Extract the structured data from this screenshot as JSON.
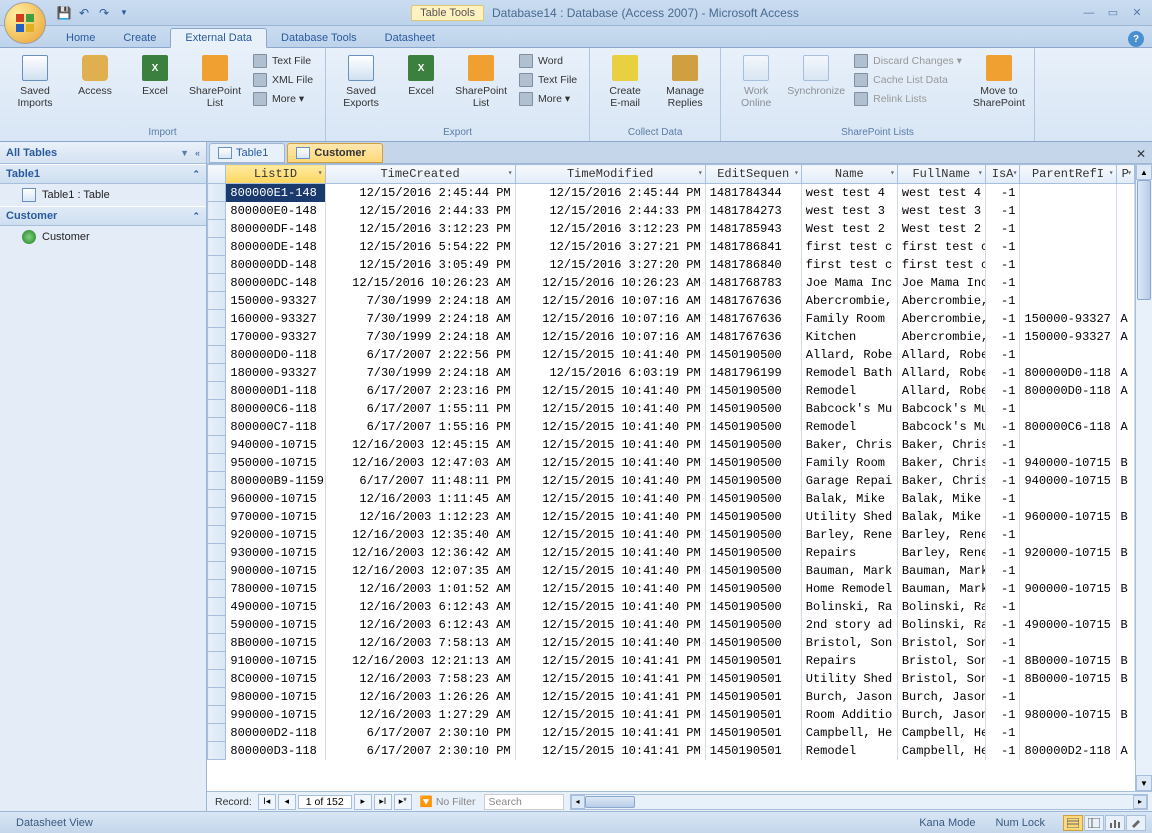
{
  "title": {
    "table_tools": "Table Tools",
    "text": "Database14 : Database (Access 2007) - Microsoft Access"
  },
  "tabs": [
    "Home",
    "Create",
    "External Data",
    "Database Tools",
    "Datasheet"
  ],
  "active_tab": "External Data",
  "ribbon": {
    "groups": [
      {
        "label": "Import",
        "items_big": [
          {
            "label": "Saved\nImports",
            "icon": "db"
          },
          {
            "label": "Access",
            "icon": "key"
          },
          {
            "label": "Excel",
            "icon": "xl"
          },
          {
            "label": "SharePoint\nList",
            "icon": "sp"
          }
        ],
        "items_small": [
          {
            "label": "Text File"
          },
          {
            "label": "XML File"
          },
          {
            "label": "More ▾"
          }
        ]
      },
      {
        "label": "Export",
        "items_big": [
          {
            "label": "Saved\nExports",
            "icon": "db"
          },
          {
            "label": "Excel",
            "icon": "xl"
          },
          {
            "label": "SharePoint\nList",
            "icon": "sp"
          }
        ],
        "items_small": [
          {
            "label": "Word"
          },
          {
            "label": "Text File"
          },
          {
            "label": "More ▾"
          }
        ]
      },
      {
        "label": "Collect Data",
        "items_big": [
          {
            "label": "Create\nE-mail",
            "icon": "mail"
          },
          {
            "label": "Manage\nReplies",
            "icon": "people"
          }
        ],
        "items_small": []
      },
      {
        "label": "SharePoint Lists",
        "items_big": [
          {
            "label": "Work\nOnline",
            "icon": "db",
            "disabled": true
          },
          {
            "label": "Synchronize",
            "icon": "db",
            "disabled": true
          }
        ],
        "items_small": [
          {
            "label": "Discard Changes ▾",
            "disabled": true
          },
          {
            "label": "Cache List Data",
            "disabled": true
          },
          {
            "label": "Relink Lists",
            "disabled": true
          }
        ],
        "extra_big": [
          {
            "label": "Move to\nSharePoint",
            "icon": "sp"
          }
        ]
      }
    ]
  },
  "nav": {
    "header": "All Tables",
    "groups": [
      {
        "name": "Table1",
        "items": [
          {
            "label": "Table1 : Table",
            "icon": "table"
          }
        ]
      },
      {
        "name": "Customer",
        "items": [
          {
            "label": "Customer",
            "icon": "link"
          }
        ]
      }
    ]
  },
  "doc_tabs": [
    {
      "label": "Table1",
      "active": false
    },
    {
      "label": "Customer",
      "active": true
    }
  ],
  "columns": [
    "ListID",
    "TimeCreated",
    "TimeModified",
    "EditSequen",
    "Name",
    "FullName",
    "IsA",
    "ParentRefI",
    "P"
  ],
  "selected_column": "ListID",
  "rows": [
    [
      "800000E1-148",
      "12/15/2016 2:45:44 PM",
      "12/15/2016 2:45:44 PM",
      "1481784344",
      "west test 4",
      "west test 4",
      "-1",
      "",
      ""
    ],
    [
      "800000E0-148",
      "12/15/2016 2:44:33 PM",
      "12/15/2016 2:44:33 PM",
      "1481784273",
      "west test 3",
      "west test 3",
      "-1",
      "",
      ""
    ],
    [
      "800000DF-148",
      "12/15/2016 3:12:23 PM",
      "12/15/2016 3:12:23 PM",
      "1481785943",
      "West test 2",
      "West test 2",
      "-1",
      "",
      ""
    ],
    [
      "800000DE-148",
      "12/15/2016 5:54:22 PM",
      "12/15/2016 3:27:21 PM",
      "1481786841",
      "first test c",
      "first test c",
      "-1",
      "",
      ""
    ],
    [
      "800000DD-148",
      "12/15/2016 3:05:49 PM",
      "12/15/2016 3:27:20 PM",
      "1481786840",
      "first test c",
      "first test c",
      "-1",
      "",
      ""
    ],
    [
      "800000DC-148",
      "12/15/2016 10:26:23 AM",
      "12/15/2016 10:26:23 AM",
      "1481768783",
      "Joe Mama Inc",
      "Joe Mama Inc",
      "-1",
      "",
      ""
    ],
    [
      "150000-93327",
      "7/30/1999 2:24:18 AM",
      "12/15/2016 10:07:16 AM",
      "1481767636",
      "Abercrombie,",
      "Abercrombie,",
      "-1",
      "",
      ""
    ],
    [
      "160000-93327",
      "7/30/1999 2:24:18 AM",
      "12/15/2016 10:07:16 AM",
      "1481767636",
      "Family Room",
      "Abercrombie,",
      "-1",
      "150000-93327",
      "A"
    ],
    [
      "170000-93327",
      "7/30/1999 2:24:18 AM",
      "12/15/2016 10:07:16 AM",
      "1481767636",
      "Kitchen",
      "Abercrombie,",
      "-1",
      "150000-93327",
      "A"
    ],
    [
      "800000D0-118",
      "6/17/2007 2:22:56 PM",
      "12/15/2015 10:41:40 PM",
      "1450190500",
      "Allard, Robe",
      "Allard, Robe",
      "-1",
      "",
      ""
    ],
    [
      "180000-93327",
      "7/30/1999 2:24:18 AM",
      "12/15/2016 6:03:19 PM",
      "1481796199",
      "Remodel Bath",
      "Allard, Robe",
      "-1",
      "800000D0-118",
      "A"
    ],
    [
      "800000D1-118",
      "6/17/2007 2:23:16 PM",
      "12/15/2015 10:41:40 PM",
      "1450190500",
      "Remodel",
      "Allard, Robe",
      "-1",
      "800000D0-118",
      "A"
    ],
    [
      "800000C6-118",
      "6/17/2007 1:55:11 PM",
      "12/15/2015 10:41:40 PM",
      "1450190500",
      "Babcock's Mu",
      "Babcock's Mu",
      "-1",
      "",
      ""
    ],
    [
      "800000C7-118",
      "6/17/2007 1:55:16 PM",
      "12/15/2015 10:41:40 PM",
      "1450190500",
      "Remodel",
      "Babcock's Mu",
      "-1",
      "800000C6-118",
      "A"
    ],
    [
      "940000-10715",
      "12/16/2003 12:45:15 AM",
      "12/15/2015 10:41:40 PM",
      "1450190500",
      "Baker, Chris",
      "Baker, Chris",
      "-1",
      "",
      ""
    ],
    [
      "950000-10715",
      "12/16/2003 12:47:03 AM",
      "12/15/2015 10:41:40 PM",
      "1450190500",
      "Family Room",
      "Baker, Chris",
      "-1",
      "940000-10715",
      "B"
    ],
    [
      "800000B9-1159",
      "6/17/2007 11:48:11 PM",
      "12/15/2015 10:41:40 PM",
      "1450190500",
      "Garage Repai",
      "Baker, Chris",
      "-1",
      "940000-10715",
      "B"
    ],
    [
      "960000-10715",
      "12/16/2003 1:11:45 AM",
      "12/15/2015 10:41:40 PM",
      "1450190500",
      "Balak, Mike",
      "Balak, Mike",
      "-1",
      "",
      ""
    ],
    [
      "970000-10715",
      "12/16/2003 1:12:23 AM",
      "12/15/2015 10:41:40 PM",
      "1450190500",
      "Utility Shed",
      "Balak, Mike",
      "-1",
      "960000-10715",
      "B"
    ],
    [
      "920000-10715",
      "12/16/2003 12:35:40 AM",
      "12/15/2015 10:41:40 PM",
      "1450190500",
      "Barley, Rene",
      "Barley, Rene",
      "-1",
      "",
      ""
    ],
    [
      "930000-10715",
      "12/16/2003 12:36:42 AM",
      "12/15/2015 10:41:40 PM",
      "1450190500",
      "Repairs",
      "Barley, Rene",
      "-1",
      "920000-10715",
      "B"
    ],
    [
      "900000-10715",
      "12/16/2003 12:07:35 AM",
      "12/15/2015 10:41:40 PM",
      "1450190500",
      "Bauman, Mark",
      "Bauman, Mark",
      "-1",
      "",
      ""
    ],
    [
      "780000-10715",
      "12/16/2003 1:01:52 AM",
      "12/15/2015 10:41:40 PM",
      "1450190500",
      "Home Remodel",
      "Bauman, Mark",
      "-1",
      "900000-10715",
      "B"
    ],
    [
      "490000-10715",
      "12/16/2003 6:12:43 AM",
      "12/15/2015 10:41:40 PM",
      "1450190500",
      "Bolinski, Ra",
      "Bolinski, Ra",
      "-1",
      "",
      ""
    ],
    [
      "590000-10715",
      "12/16/2003 6:12:43 AM",
      "12/15/2015 10:41:40 PM",
      "1450190500",
      "2nd story ad",
      "Bolinski, Ra",
      "-1",
      "490000-10715",
      "B"
    ],
    [
      "8B0000-10715",
      "12/16/2003 7:58:13 AM",
      "12/15/2015 10:41:40 PM",
      "1450190500",
      "Bristol, Son",
      "Bristol, Son",
      "-1",
      "",
      ""
    ],
    [
      "910000-10715",
      "12/16/2003 12:21:13 AM",
      "12/15/2015 10:41:41 PM",
      "1450190501",
      "Repairs",
      "Bristol, Son",
      "-1",
      "8B0000-10715",
      "B"
    ],
    [
      "8C0000-10715",
      "12/16/2003 7:58:23 AM",
      "12/15/2015 10:41:41 PM",
      "1450190501",
      "Utility Shed",
      "Bristol, Son",
      "-1",
      "8B0000-10715",
      "B"
    ],
    [
      "980000-10715",
      "12/16/2003 1:26:26 AM",
      "12/15/2015 10:41:41 PM",
      "1450190501",
      "Burch, Jason",
      "Burch, Jason",
      "-1",
      "",
      ""
    ],
    [
      "990000-10715",
      "12/16/2003 1:27:29 AM",
      "12/15/2015 10:41:41 PM",
      "1450190501",
      "Room Additio",
      "Burch, Jason",
      "-1",
      "980000-10715",
      "B"
    ],
    [
      "800000D2-118",
      "6/17/2007 2:30:10 PM",
      "12/15/2015 10:41:41 PM",
      "1450190501",
      "Campbell, He",
      "Campbell, He",
      "-1",
      "",
      ""
    ],
    [
      "800000D3-118",
      "6/17/2007 2:30:10 PM",
      "12/15/2015 10:41:41 PM",
      "1450190501",
      "Remodel",
      "Campbell, He",
      "-1",
      "800000D2-118",
      "A"
    ]
  ],
  "record_nav": {
    "label": "Record:",
    "position": "1 of 152",
    "filter": "No Filter",
    "search": "Search"
  },
  "status": {
    "left": "Datasheet View",
    "kana": "Kana Mode",
    "num": "Num Lock"
  }
}
